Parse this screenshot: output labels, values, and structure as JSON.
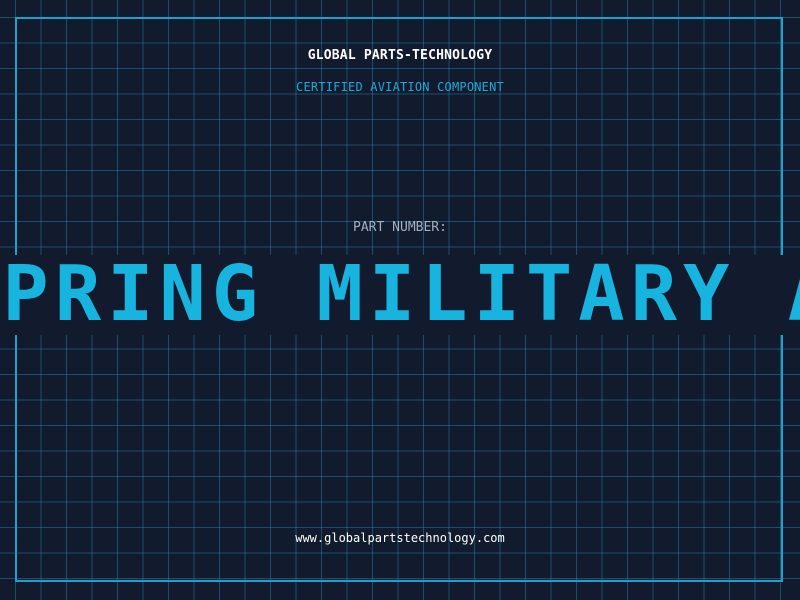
{
  "header": {
    "company": "GLOBAL PARTS-TECHNOLOGY",
    "tagline": "CERTIFIED AVIATION COMPONENT"
  },
  "part": {
    "label": "PART NUMBER:",
    "value": "SPRING MILITARY AIRCRAFT"
  },
  "footer": {
    "website": "www.globalpartstechnology.com"
  },
  "colors": {
    "background": "#121a2e",
    "accent": "#1aa2cc",
    "text": "#ffffff",
    "muted": "#a5b0c1"
  }
}
